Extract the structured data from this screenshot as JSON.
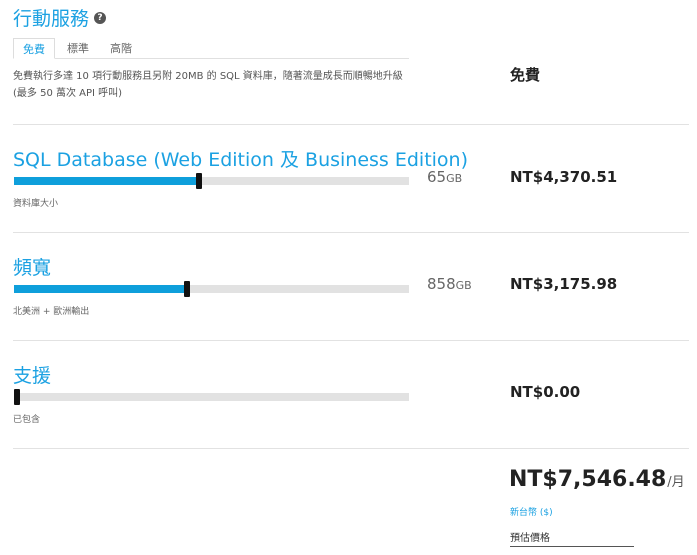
{
  "header": {
    "title": "行動服務",
    "help_icon": "question-circle-icon"
  },
  "tabs": [
    {
      "label": "免費",
      "active": true
    },
    {
      "label": "標準"
    },
    {
      "label": "高階"
    }
  ],
  "description": "免費執行多達 10 項行動服務且另附 20MB 的 SQL 資料庫，隨著流量成長而順暢地升級 (最多 50 萬次 API 呼叫)",
  "base_price": "免費",
  "sections": {
    "sql": {
      "title": "SQL Database (Web Edition 及 Business Edition)",
      "value": "65",
      "unit": "GB",
      "level": 0.46,
      "caption": "資料庫大小",
      "price": "NT$4,370.51"
    },
    "bandwidth": {
      "title": "頻寬",
      "value": "858",
      "unit": "GB",
      "level": 0.43,
      "caption": "北美洲 + 歐洲輸出",
      "price": "NT$3,175.98"
    },
    "support": {
      "title": "支援",
      "level": 0.0,
      "caption": "已包含",
      "price": "NT$0.00"
    }
  },
  "total": {
    "amount": "NT$7,546.48",
    "period": "/月",
    "currency_link": "新台幣 ($)",
    "estimate_label": "預估價格"
  },
  "colors": {
    "accent": "#1ba1e2",
    "slider_fill": "#0e9fdb",
    "track": "#e2e2e2"
  }
}
